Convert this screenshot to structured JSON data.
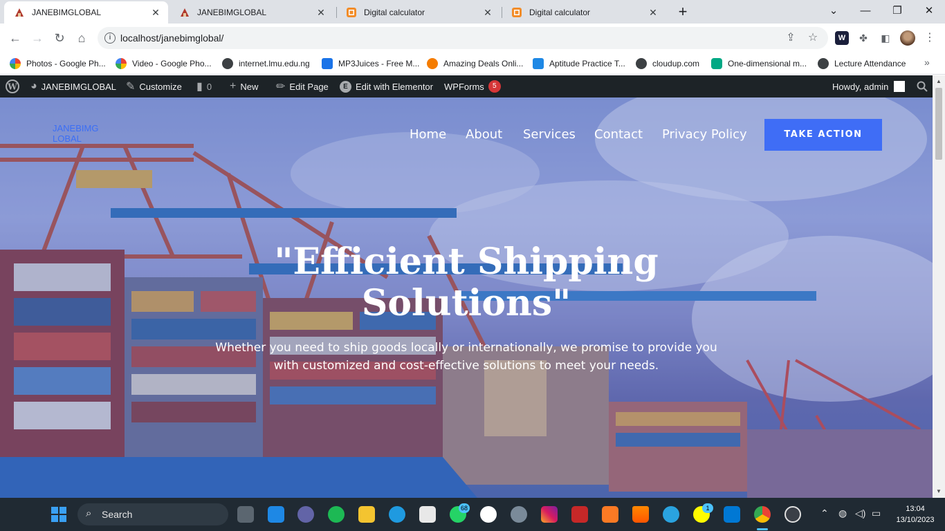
{
  "browser": {
    "tabs": [
      {
        "title": "JANEBIMGLOBAL",
        "active": true,
        "favicon": "janebim-favicon"
      },
      {
        "title": "JANEBIMGLOBAL",
        "active": false,
        "favicon": "janebim-favicon"
      },
      {
        "title": "Digital calculator",
        "active": false,
        "favicon": "calculator-favicon"
      },
      {
        "title": "Digital calculator",
        "active": false,
        "favicon": "calculator-favicon"
      }
    ],
    "url": "localhost/janebimglobal/",
    "bookmarks": [
      {
        "label": "Photos - Google Ph...",
        "color": "#fbbc04"
      },
      {
        "label": "Video - Google Pho...",
        "color": "#34a853"
      },
      {
        "label": "internet.lmu.edu.ng",
        "color": "#3c4043"
      },
      {
        "label": "MP3Juices - Free M...",
        "color": "#1a73e8"
      },
      {
        "label": "Amazing Deals Onli...",
        "color": "#f57c00"
      },
      {
        "label": "Aptitude Practice T...",
        "color": "#1e88e5"
      },
      {
        "label": "cloudup.com",
        "color": "#3c4043"
      },
      {
        "label": "One-dimensional m...",
        "color": "#00a884"
      },
      {
        "label": "Lecture Attendance",
        "color": "#3c4043"
      }
    ]
  },
  "wpbar": {
    "site": "JANEBIMGLOBAL",
    "customize": "Customize",
    "comments": "0",
    "new": "New",
    "edit_page": "Edit Page",
    "elementor": "Edit with Elementor",
    "wpforms": "WPForms",
    "wpforms_count": "5",
    "howdy": "Howdy, admin"
  },
  "site": {
    "logo_alt": "JANEBIMG LOBAL",
    "menu": [
      "Home",
      "About",
      "Services",
      "Contact",
      "Privacy Policy"
    ],
    "cta": "TAKE ACTION",
    "headline_line1": "\"Efficient Shipping",
    "headline_line2": "Solutions\"",
    "subline_line1": "Whether you need to ship goods locally or internationally, we promise to provide you",
    "subline_line2": "with customized and cost-effective solutions to meet your needs."
  },
  "taskbar": {
    "search": "Search",
    "whatsapp_badge": "68",
    "snapchat_badge": "1",
    "time": "13:04",
    "date": "13/10/2023"
  },
  "colors": {
    "accent": "#3f6df6",
    "wp_bar": "#1d2327",
    "taskbar": "#202a33"
  }
}
